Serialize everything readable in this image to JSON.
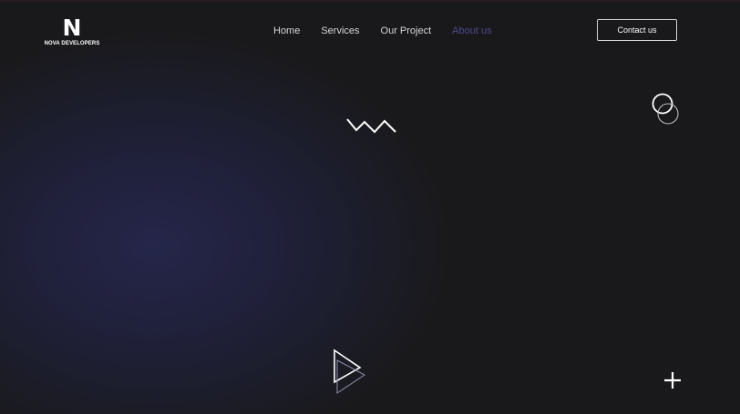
{
  "logo": {
    "mark": "N",
    "name": "NOVA DEVELOPERS"
  },
  "nav": {
    "items": [
      {
        "label": "Home"
      },
      {
        "label": "Services"
      },
      {
        "label": "Our Project"
      },
      {
        "label": "About us",
        "active": true
      }
    ]
  },
  "header": {
    "contact_label": "Contact us"
  },
  "colors": {
    "background": "#19191b",
    "glow": "#25264a",
    "nav_text": "#d6d6d6",
    "nav_active": "#4d4a8e",
    "accent_white": "#ffffff"
  },
  "decorations": [
    "zigzag-icon",
    "double-circle-icon",
    "play-triangle-icon",
    "plus-icon"
  ]
}
